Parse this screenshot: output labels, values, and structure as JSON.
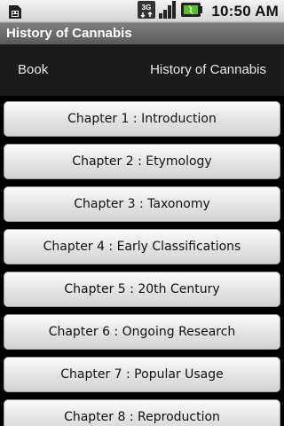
{
  "status_bar": {
    "time": "10:50 AM",
    "network": "3G",
    "icons": [
      "sim-card-icon",
      "signal-icon",
      "battery-icon"
    ]
  },
  "title_bar": {
    "title": "History of Cannabis"
  },
  "header": {
    "left_label": "Book",
    "right_label": "History of Cannabis"
  },
  "chapters": [
    "Chapter 1 : Introduction",
    "Chapter 2 : Etymology",
    "Chapter 3 : Taxonomy",
    "Chapter 4 : Early Classifications",
    "Chapter 5 : 20th Century",
    "Chapter 6 : Ongoing Research",
    "Chapter 7 : Popular Usage",
    "Chapter 8 : Reproduction"
  ]
}
